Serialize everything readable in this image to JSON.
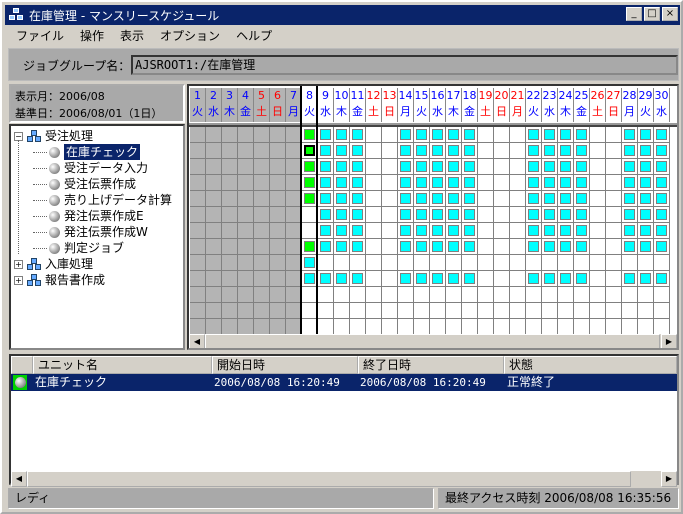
{
  "window": {
    "title": "在庫管理 - マンスリースケジュール",
    "minimize": "_",
    "maximize": "□",
    "close": "×"
  },
  "menu": [
    "ファイル",
    "操作",
    "表示",
    "オプション",
    "ヘルプ"
  ],
  "jobgroup": {
    "label": "ジョブグループ名：",
    "value": "AJSROOT1:/在庫管理"
  },
  "info": {
    "month": "表示月：2006/08",
    "base": "基準日：2006/08/01（1日）"
  },
  "tree": [
    {
      "label": "受注処理",
      "type": "group",
      "expand": "−",
      "level": 0
    },
    {
      "label": "在庫チェック",
      "type": "job",
      "level": 1,
      "selected": true
    },
    {
      "label": "受注データ入力",
      "type": "job",
      "level": 1
    },
    {
      "label": "受注伝票作成",
      "type": "job",
      "level": 1
    },
    {
      "label": "売り上げデータ計算",
      "type": "job",
      "level": 1
    },
    {
      "label": "発注伝票作成E",
      "type": "job",
      "level": 1
    },
    {
      "label": "発注伝票作成W",
      "type": "job",
      "level": 1
    },
    {
      "label": "判定ジョブ",
      "type": "job",
      "level": 1
    },
    {
      "label": "入庫処理",
      "type": "group",
      "expand": "+",
      "level": 0
    },
    {
      "label": "報告書作成",
      "type": "group",
      "expand": "+",
      "level": 0
    }
  ],
  "calendar": {
    "today": 8,
    "days": [
      {
        "d": "1",
        "w": "火"
      },
      {
        "d": "2",
        "w": "水"
      },
      {
        "d": "3",
        "w": "木"
      },
      {
        "d": "4",
        "w": "金"
      },
      {
        "d": "5",
        "w": "土",
        "holiday": true
      },
      {
        "d": "6",
        "w": "日",
        "holiday": true
      },
      {
        "d": "7",
        "w": "月"
      },
      {
        "d": "8",
        "w": "火"
      },
      {
        "d": "9",
        "w": "水"
      },
      {
        "d": "10",
        "w": "木"
      },
      {
        "d": "11",
        "w": "金"
      },
      {
        "d": "12",
        "w": "土",
        "holiday": true
      },
      {
        "d": "13",
        "w": "日",
        "holiday": true
      },
      {
        "d": "14",
        "w": "月"
      },
      {
        "d": "15",
        "w": "火"
      },
      {
        "d": "16",
        "w": "水"
      },
      {
        "d": "17",
        "w": "木"
      },
      {
        "d": "18",
        "w": "金"
      },
      {
        "d": "19",
        "w": "土",
        "holiday": true
      },
      {
        "d": "20",
        "w": "日",
        "holiday": true
      },
      {
        "d": "21",
        "w": "月",
        "holiday": true
      },
      {
        "d": "22",
        "w": "火"
      },
      {
        "d": "23",
        "w": "水"
      },
      {
        "d": "24",
        "w": "木"
      },
      {
        "d": "25",
        "w": "金"
      },
      {
        "d": "26",
        "w": "土",
        "holiday": true
      },
      {
        "d": "27",
        "w": "日",
        "holiday": true
      },
      {
        "d": "28",
        "w": "月"
      },
      {
        "d": "29",
        "w": "火"
      },
      {
        "d": "30",
        "w": "水"
      }
    ],
    "scheduled_days": [
      9,
      10,
      11,
      14,
      15,
      16,
      17,
      18,
      22,
      23,
      24,
      25,
      28,
      29,
      30
    ],
    "rows": [
      {
        "today": "ended",
        "future": true
      },
      {
        "today": "ended-selected",
        "future": true
      },
      {
        "today": "ended",
        "future": true
      },
      {
        "today": "ended",
        "future": true
      },
      {
        "today": "ended",
        "future": true
      },
      {
        "today": "none",
        "future": true
      },
      {
        "today": "none",
        "future": true
      },
      {
        "today": "ended",
        "future": true
      },
      {
        "today": "scheduled",
        "future": false
      },
      {
        "today": "scheduled",
        "future": true
      }
    ],
    "colors": {
      "ended": "#00ff00",
      "scheduled": "#00ffff",
      "holiday": "#ff0000",
      "weekday": "#0000ff",
      "past": "#b4b4b4"
    }
  },
  "list": {
    "headers": [
      "ユニット名",
      "開始日時",
      "終了日時",
      "状態"
    ],
    "rows": [
      {
        "name": "在庫チェック",
        "start": "2006/08/08 16:20:49",
        "end": "2006/08/08 16:20:49",
        "status": "正常終了"
      }
    ]
  },
  "statusbar": {
    "text": "レディ",
    "access": "最終アクセス時刻 2006/08/08 16:35:56"
  }
}
